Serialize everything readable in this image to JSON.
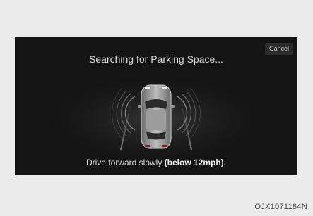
{
  "dialog": {
    "cancel_label": "Cancel",
    "title": "Searching for Parking Space...",
    "instruction_prefix": "Drive forward slowly ",
    "instruction_emphasis": "(below 12mph)."
  },
  "image_code": "OJX1071184N",
  "icons": {
    "vehicle": "car-top-view-icon",
    "sensor_left": "sensor-waves-left-icon",
    "sensor_right": "sensor-waves-right-icon"
  },
  "colors": {
    "page_background": "#ebebeb",
    "screen_background": "#141414",
    "text": "#dcdcdc"
  }
}
